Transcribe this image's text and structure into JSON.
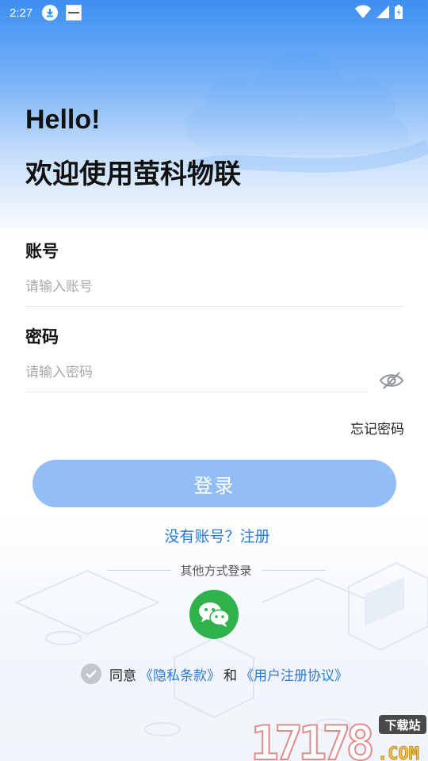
{
  "status_bar": {
    "time": "2:27",
    "icons": [
      "download-notification-icon",
      "app-notification-icon",
      "wifi-icon",
      "signal-icon",
      "battery-icon"
    ]
  },
  "header": {
    "greeting": "Hello!",
    "welcome": "欢迎使用萤科物联"
  },
  "account": {
    "label": "账号",
    "placeholder": "请输入账号",
    "value": ""
  },
  "password": {
    "label": "密码",
    "placeholder": "请输入密码",
    "value": "",
    "visibility_icon": "eye-icon"
  },
  "forgot_password": "忘记密码",
  "login_button": "登录",
  "register_link": "没有账号？注册",
  "other_login": {
    "label": "其他方式登录",
    "methods": [
      "wechat-icon"
    ]
  },
  "agreement": {
    "agree": "同意",
    "privacy": "《隐私条款》",
    "and": "和",
    "terms": "《用户注册协议》"
  },
  "watermark": {
    "brand": "17178",
    "domain": ".COM",
    "badge": "下载站"
  },
  "colors": {
    "primary_blue": "#2a7ad8",
    "login_button": "#93bdf6",
    "wechat_green": "#2fb24c",
    "header_gradient_top": "#3d8ff2"
  }
}
